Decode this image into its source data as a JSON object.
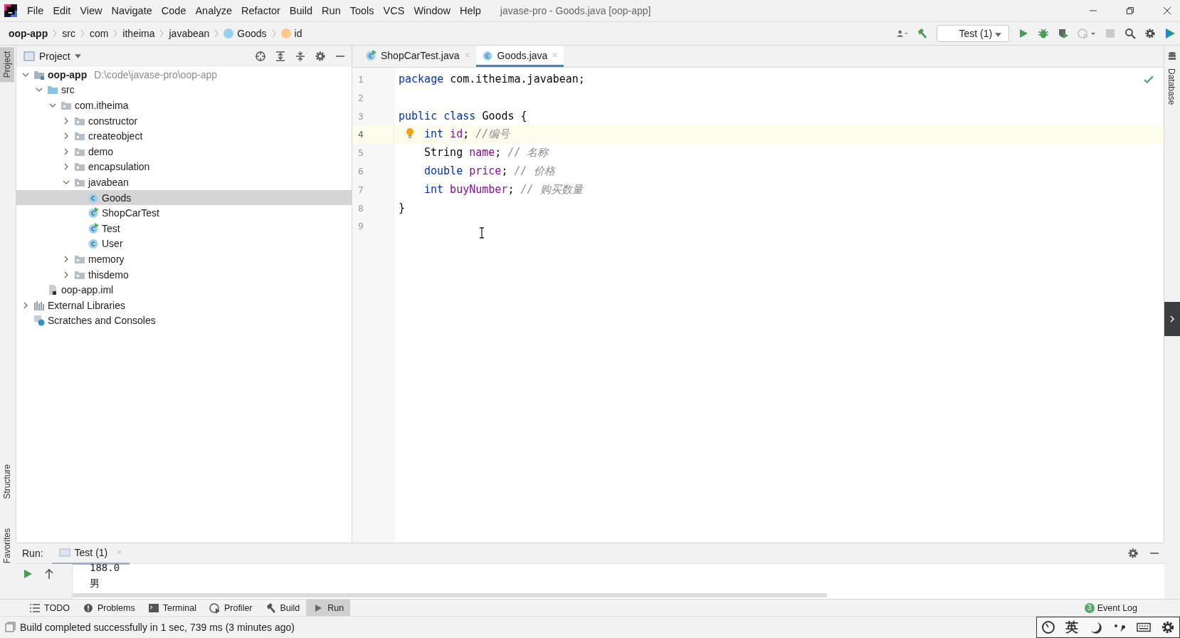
{
  "menu": [
    "File",
    "Edit",
    "View",
    "Navigate",
    "Code",
    "Analyze",
    "Refactor",
    "Build",
    "Run",
    "Tools",
    "VCS",
    "Window",
    "Help"
  ],
  "window": {
    "title": "javase-pro - Goods.java [oop-app]"
  },
  "breadcrumb": [
    {
      "label": "oop-app",
      "kind": "module"
    },
    {
      "label": "src",
      "kind": "folder"
    },
    {
      "label": "com",
      "kind": "folder"
    },
    {
      "label": "itheima",
      "kind": "folder"
    },
    {
      "label": "javabean",
      "kind": "folder"
    },
    {
      "label": "Goods",
      "kind": "class"
    },
    {
      "label": "id",
      "kind": "field"
    }
  ],
  "run_config": "Test (1)",
  "side_left": [
    {
      "label": "Project",
      "selected": true
    },
    {
      "label": "Structure",
      "selected": false
    },
    {
      "label": "Favorites",
      "selected": false
    }
  ],
  "side_right": [
    {
      "label": "Database"
    }
  ],
  "project_panel": {
    "title": "Project"
  },
  "tree": [
    {
      "label": "oop-app",
      "kind": "module",
      "hint": "D:\\code\\javase-pro\\oop-app",
      "expanded": true,
      "selected": false,
      "children": [
        {
          "label": "src",
          "kind": "source",
          "expanded": true,
          "selected": false,
          "children": [
            {
              "label": "com.itheima",
              "kind": "package",
              "expanded": true,
              "selected": false,
              "children": [
                {
                  "label": "constructor",
                  "kind": "package",
                  "expanded": false,
                  "selected": false
                },
                {
                  "label": "createobject",
                  "kind": "package",
                  "expanded": false,
                  "selected": false
                },
                {
                  "label": "demo",
                  "kind": "package",
                  "expanded": false,
                  "selected": false
                },
                {
                  "label": "encapsulation",
                  "kind": "package",
                  "expanded": false,
                  "selected": false
                },
                {
                  "label": "javabean",
                  "kind": "package",
                  "expanded": true,
                  "selected": false,
                  "children": [
                    {
                      "label": "Goods",
                      "kind": "class",
                      "selected": true
                    },
                    {
                      "label": "ShopCarTest",
                      "kind": "runnable",
                      "selected": false
                    },
                    {
                      "label": "Test",
                      "kind": "runnable",
                      "selected": false
                    },
                    {
                      "label": "User",
                      "kind": "class",
                      "selected": false
                    }
                  ]
                },
                {
                  "label": "memory",
                  "kind": "package",
                  "expanded": false,
                  "selected": false
                },
                {
                  "label": "thisdemo",
                  "kind": "package",
                  "expanded": false,
                  "selected": false
                }
              ]
            }
          ]
        },
        {
          "label": "oop-app.iml",
          "kind": "file",
          "selected": false
        }
      ]
    },
    {
      "label": "External Libraries",
      "kind": "libraries",
      "expanded": false,
      "selected": false
    },
    {
      "label": "Scratches and Consoles",
      "kind": "scratches",
      "selected": false
    }
  ],
  "editor_tabs": [
    {
      "label": "ShopCarTest.java",
      "kind": "runnable",
      "selected": false
    },
    {
      "label": "Goods.java",
      "kind": "class",
      "selected": true
    }
  ],
  "code": [
    {
      "number": "1",
      "current": false,
      "indented": false,
      "tokens": [
        {
          "text": "package",
          "kind": "keyword"
        },
        {
          "text": " com.itheima.javabean;",
          "kind": "plain"
        }
      ]
    },
    {
      "number": "2",
      "current": false
    },
    {
      "number": "3",
      "current": false,
      "indented": false,
      "tokens": [
        {
          "text": "public class",
          "kind": "keyword"
        },
        {
          "text": " Goods {",
          "kind": "plain"
        }
      ]
    },
    {
      "number": "4",
      "current": true,
      "indented": true,
      "tokens": [
        {
          "text": "int",
          "kind": "keyword"
        },
        {
          "text": " id",
          "kind": "field"
        },
        {
          "text": "; ",
          "kind": "plain"
        },
        {
          "text": "//编号",
          "kind": "comment"
        }
      ]
    },
    {
      "number": "5",
      "current": false,
      "indented": true,
      "tokens": [
        {
          "text": "String",
          "kind": "plain"
        },
        {
          "text": " name",
          "kind": "field"
        },
        {
          "text": "; ",
          "kind": "plain"
        },
        {
          "text": "// 名称",
          "kind": "comment"
        }
      ]
    },
    {
      "number": "6",
      "current": false,
      "indented": true,
      "tokens": [
        {
          "text": "double",
          "kind": "keyword"
        },
        {
          "text": " price",
          "kind": "field"
        },
        {
          "text": "; ",
          "kind": "plain"
        },
        {
          "text": "// 价格",
          "kind": "comment"
        }
      ]
    },
    {
      "number": "7",
      "current": false,
      "indented": true,
      "tokens": [
        {
          "text": "int",
          "kind": "keyword"
        },
        {
          "text": " buyNumber",
          "kind": "field"
        },
        {
          "text": "; ",
          "kind": "plain"
        },
        {
          "text": "// 购买数量",
          "kind": "comment"
        }
      ]
    },
    {
      "number": "8",
      "current": false,
      "indented": false,
      "tokens": [
        {
          "text": "}",
          "kind": "plain"
        }
      ]
    },
    {
      "number": "9",
      "current": false
    }
  ],
  "run_panel": {
    "label": "Run:",
    "tab": "Test (1)",
    "output": [
      "188.0",
      "男"
    ]
  },
  "tool_tabs": [
    {
      "label": "TODO",
      "kind": "todo",
      "selected": false
    },
    {
      "label": "Problems",
      "kind": "problems",
      "selected": false
    },
    {
      "label": "Terminal",
      "kind": "terminal",
      "selected": false
    },
    {
      "label": "Profiler",
      "kind": "profiler",
      "selected": false
    },
    {
      "label": "Build",
      "kind": "build",
      "selected": false
    },
    {
      "label": "Run",
      "kind": "run",
      "selected": true
    }
  ],
  "event_log": {
    "count": "3",
    "label": "Event Log"
  },
  "status_bar": "Build completed successfully in 1 sec, 739 ms (3 minutes ago)",
  "ime": {
    "mode": "英"
  }
}
